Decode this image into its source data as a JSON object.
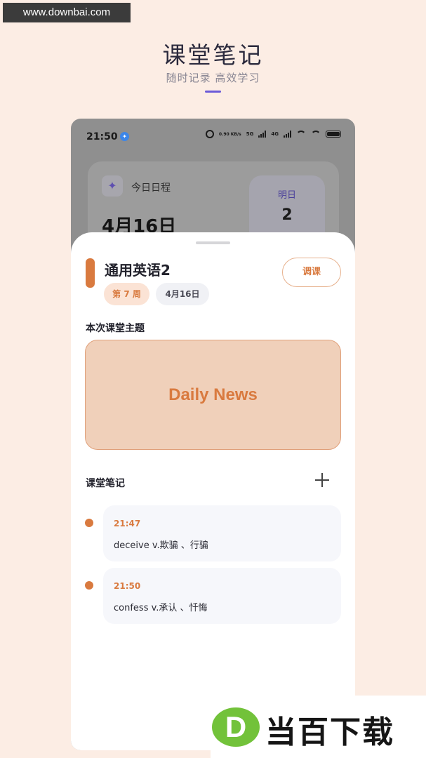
{
  "watermark": {
    "url": "www.downbai.com"
  },
  "promo": {
    "title": "课堂笔记",
    "subtitle": "随时记录 高效学习",
    "accent": "#6b5ad8"
  },
  "statusbar": {
    "time": "21:50",
    "speed": "0.90 KB/s",
    "net1": "5G",
    "net2": "4G"
  },
  "background_card": {
    "label": "今日日程",
    "date": "4月16日",
    "tomorrow_label": "明日",
    "tomorrow_count": "2"
  },
  "course": {
    "title": "通用英语2",
    "week_tag": "第 7 周",
    "date_tag": "4月16日",
    "reschedule_label": "调课",
    "accent": "#d97a3f"
  },
  "topic": {
    "heading": "本次课堂主题",
    "value": "Daily News"
  },
  "notes": {
    "heading": "课堂笔记",
    "items": [
      {
        "time": "21:47",
        "text": "deceive v.欺骗 、行骗"
      },
      {
        "time": "21:50",
        "text": "confess v.承认 、忏悔"
      }
    ]
  },
  "brand_logo": {
    "letter": "D",
    "text": "当百下载"
  }
}
